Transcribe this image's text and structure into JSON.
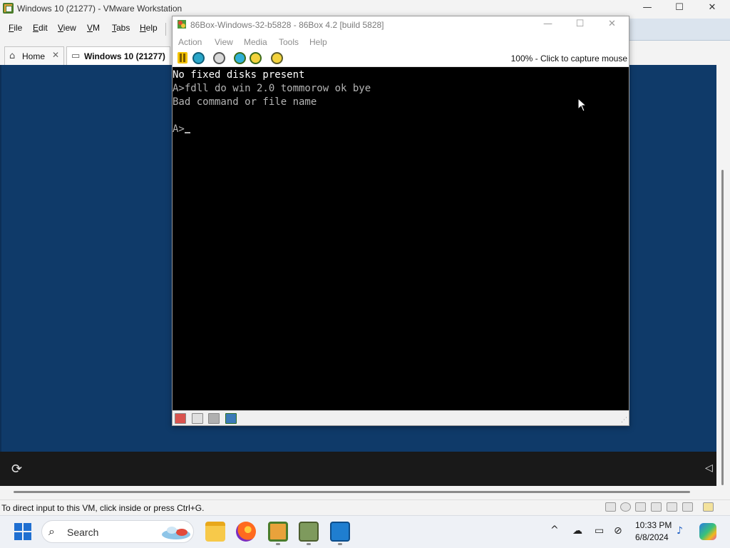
{
  "vmware": {
    "title": "Windows 10 (21277) - VMware Workstation",
    "window_controls": {
      "minimize": "—",
      "maximize": "☐",
      "close": "✕"
    },
    "menu": [
      {
        "first": "F",
        "rest": "ile"
      },
      {
        "first": "E",
        "rest": "dit"
      },
      {
        "first": "V",
        "rest": "iew"
      },
      {
        "first": "V",
        "rest": "M"
      },
      {
        "first": "T",
        "rest": "abs"
      },
      {
        "first": "H",
        "rest": "elp"
      }
    ],
    "tabs": [
      {
        "label": "Home",
        "icon": "home-icon",
        "close": "✕"
      },
      {
        "label": "Windows 10 (21277)",
        "icon": "vm-icon"
      }
    ],
    "status_text": "To direct input to this VM, click inside or press Ctrl+G."
  },
  "box86": {
    "title": "86Box-Windows-32-b5828 - 86Box 4.2 [build 5828]",
    "window_controls": {
      "minimize": "—",
      "maximize": "☐",
      "close": "✕"
    },
    "menu": [
      "Action",
      "View",
      "Media",
      "Tools",
      "Help"
    ],
    "toolbar_icons": [
      "pause-icon",
      "reset-icon",
      "ctrl-alt-del-icon",
      "settings-icon",
      "settings-icon",
      "settings-icon"
    ],
    "capture_text": "100% - Click to capture mouse",
    "screen": {
      "line1": "No fixed disks present",
      "line2": "A>fdll do win 2.0 tommorow ok bye",
      "line3": "Bad command or file name",
      "line4": "",
      "prompt": "A>"
    },
    "statusbar_icons": [
      "floppy-drive-icon",
      "floppy-drive-icon",
      "cdrom-icon",
      "sound-icon"
    ]
  },
  "host_taskbar": {
    "search_label": "Search",
    "apps": [
      "file-explorer-icon",
      "firefox-icon",
      "vmware-icon",
      "86box-icon",
      "monitor-icon"
    ],
    "tray_chevron": "^",
    "clock_time": "10:33 PM",
    "clock_date": "6/8/2024"
  },
  "colors": {
    "guest_background": "#0f3a69",
    "dos_background": "#000000",
    "dos_text": "#b4b4b4"
  }
}
